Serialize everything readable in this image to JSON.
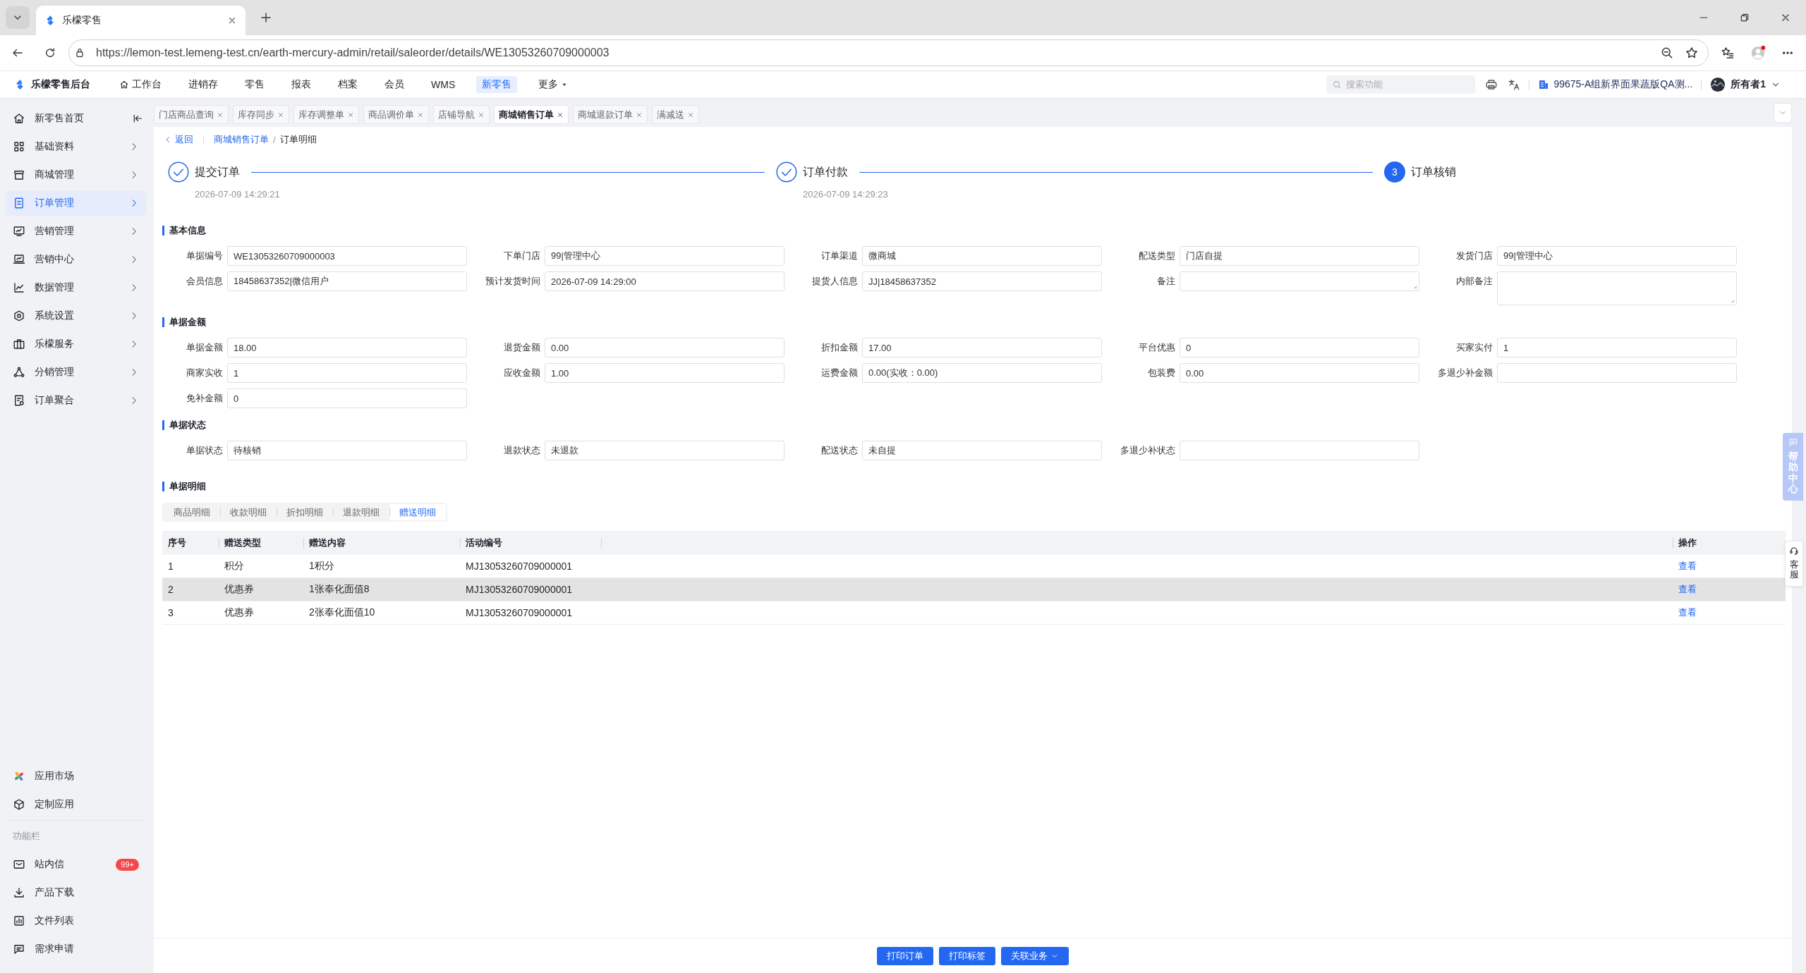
{
  "browser": {
    "tab_title": "乐檬零售",
    "url": "https://lemon-test.lemeng-test.cn/earth-mercury-admin/retail/saleorder/details/WE13053260709000003"
  },
  "header": {
    "brand": "乐檬零售后台",
    "nav": [
      {
        "label": "工作台",
        "kind": "home",
        "selected": false
      },
      {
        "label": "进销存",
        "kind": "link",
        "selected": false
      },
      {
        "label": "零售",
        "kind": "link",
        "selected": false
      },
      {
        "label": "报表",
        "kind": "link",
        "selected": false
      },
      {
        "label": "档案",
        "kind": "link",
        "selected": false
      },
      {
        "label": "会员",
        "kind": "link",
        "selected": false
      },
      {
        "label": "WMS",
        "kind": "link",
        "selected": false
      },
      {
        "label": "新零售",
        "kind": "link",
        "selected": true
      },
      {
        "label": "更多",
        "kind": "dropdown",
        "selected": false
      }
    ],
    "search": {
      "placeholder": "搜索功能"
    },
    "store": "99675-A组新界面果蔬版QA测...",
    "user": "所有者1"
  },
  "sidebar": {
    "items": [
      {
        "label": "新零售首页",
        "kind": "page",
        "selected": false
      },
      {
        "label": "基础资料",
        "kind": "menu",
        "selected": false
      },
      {
        "label": "商城管理",
        "kind": "menu",
        "selected": false
      },
      {
        "label": "订单管理",
        "kind": "menu",
        "selected": true
      },
      {
        "label": "营销管理",
        "kind": "menu",
        "selected": false
      },
      {
        "label": "营销中心",
        "kind": "menu",
        "selected": false
      },
      {
        "label": "数据管理",
        "kind": "menu",
        "selected": false
      },
      {
        "label": "系统设置",
        "kind": "menu",
        "selected": false
      },
      {
        "label": "乐檬服务",
        "kind": "menu",
        "selected": false
      },
      {
        "label": "分销管理",
        "kind": "menu",
        "selected": false
      },
      {
        "label": "订单聚合",
        "kind": "menu",
        "selected": false
      }
    ],
    "apps": [
      "应用市场",
      "定制应用"
    ],
    "section_label": "功能栏",
    "tools": [
      {
        "label": "站内信",
        "badge": "99+"
      },
      {
        "label": "产品下载"
      },
      {
        "label": "文件列表"
      },
      {
        "label": "需求申请"
      }
    ]
  },
  "page_tabs": [
    {
      "label": "门店商品查询",
      "selected": false
    },
    {
      "label": "库存同步",
      "selected": false
    },
    {
      "label": "库存调整单",
      "selected": false
    },
    {
      "label": "商品调价单",
      "selected": false
    },
    {
      "label": "店铺导航",
      "selected": false
    },
    {
      "label": "商城销售订单",
      "selected": true
    },
    {
      "label": "商城退款订单",
      "selected": false
    },
    {
      "label": "满减送",
      "selected": false
    }
  ],
  "breadcrumb": {
    "back": "返回",
    "items": [
      "商城销售订单",
      "订单明细"
    ],
    "separator": "/"
  },
  "steps": [
    {
      "title": "提交订单",
      "time": "2026-07-09 14:29:21",
      "done": true
    },
    {
      "title": "订单付款",
      "time": "2026-07-09 14:29:23",
      "done": true
    },
    {
      "title": "订单核销",
      "number": "3",
      "done": false
    }
  ],
  "sections": [
    {
      "title": "基本信息",
      "fields": [
        {
          "label": "单据编号",
          "value": "WE13053260709000003",
          "kind": "input"
        },
        {
          "label": "下单门店",
          "value": "99|管理中心",
          "kind": "input"
        },
        {
          "label": "订单渠道",
          "value": "微商城",
          "kind": "input"
        },
        {
          "label": "配送类型",
          "value": "门店自提",
          "kind": "input"
        },
        {
          "label": "发货门店",
          "value": "99|管理中心",
          "kind": "input"
        },
        {
          "label": "会员信息",
          "value": "18458637352|微信用户",
          "kind": "input"
        },
        {
          "label": "预计发货时间",
          "value": "2026-07-09 14:29:00",
          "kind": "input"
        },
        {
          "label": "提货人信息",
          "value": "JJ|18458637352",
          "kind": "input"
        },
        {
          "label": "备注",
          "kind": "textarea"
        },
        {
          "label": "内部备注",
          "kind": "memo"
        }
      ]
    },
    {
      "title": "单据金额",
      "fields": [
        {
          "label": "单据金额",
          "value": "18.00",
          "kind": "input"
        },
        {
          "label": "退货金额",
          "value": "0.00",
          "kind": "input"
        },
        {
          "label": "折扣金额",
          "value": "17.00",
          "kind": "input"
        },
        {
          "label": "平台优惠",
          "value": "0",
          "kind": "input"
        },
        {
          "label": "买家实付",
          "value": "1",
          "kind": "input"
        },
        {
          "label": "商家实收",
          "value": "1",
          "kind": "input"
        },
        {
          "label": "应收金额",
          "value": "1.00",
          "kind": "input"
        },
        {
          "label": "运费金额",
          "value": "0.00(实收：0.00)",
          "kind": "input"
        },
        {
          "label": "包装费",
          "value": "0.00",
          "kind": "input"
        },
        {
          "label": "多退少补金额",
          "kind": "input"
        },
        {
          "label": "免补金额",
          "value": "0",
          "kind": "input"
        }
      ]
    },
    {
      "title": "单据状态",
      "fields": [
        {
          "label": "单据状态",
          "value": "待核销",
          "kind": "input"
        },
        {
          "label": "退款状态",
          "value": "未退款",
          "kind": "input"
        },
        {
          "label": "配送状态",
          "value": "未自提",
          "kind": "input"
        },
        {
          "label": "多退少补状态",
          "kind": "input"
        }
      ]
    }
  ],
  "detail": {
    "title": "单据明细",
    "tabs": [
      {
        "label": "商品明细",
        "selected": false
      },
      {
        "label": "收款明细",
        "selected": false
      },
      {
        "label": "折扣明细",
        "selected": false
      },
      {
        "label": "退款明细",
        "selected": false
      },
      {
        "label": "赠送明细",
        "selected": true
      }
    ],
    "table": {
      "columns": [
        "序号",
        "赠送类型",
        "赠送内容",
        "活动编号",
        "操作"
      ],
      "rows": [
        {
          "cells": [
            "1",
            "积分",
            "1积分",
            "MJ13053260709000001"
          ],
          "action": "查看",
          "hovered": false
        },
        {
          "cells": [
            "2",
            "优惠券",
            "1张奉化面值8",
            "MJ13053260709000001"
          ],
          "action": "查看",
          "hovered": true
        },
        {
          "cells": [
            "3",
            "优惠券",
            "2张奉化面值10",
            "MJ13053260709000001"
          ],
          "action": "查看",
          "hovered": false
        }
      ]
    }
  },
  "footer": {
    "buttons": [
      {
        "label": "打印订单",
        "kind": "button"
      },
      {
        "label": "打印标签",
        "kind": "button"
      },
      {
        "label": "关联业务",
        "kind": "dropdown"
      }
    ]
  },
  "help_float": {
    "help": "帮助中心",
    "service": "客服"
  }
}
